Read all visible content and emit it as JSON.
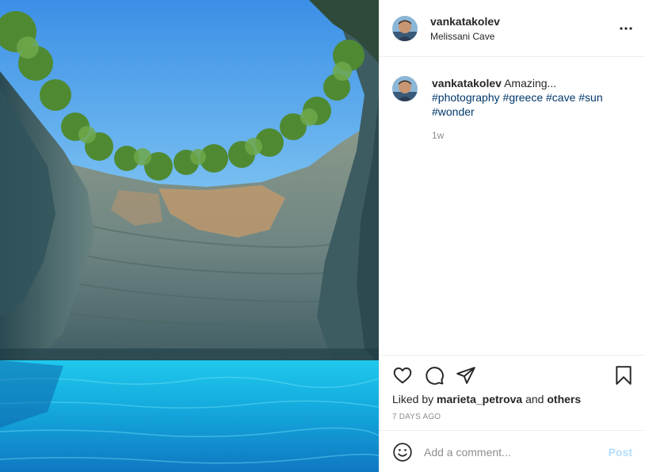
{
  "photo": {
    "description_icon": "photo-icon"
  },
  "header": {
    "username": "vankatakolev",
    "location": "Melissani Cave",
    "more_icon": "more-icon"
  },
  "caption": {
    "username": "vankatakolev",
    "text": "Amazing...",
    "hashtags": [
      "#photography",
      "#greece",
      "#cave",
      "#sun",
      "#wonder"
    ],
    "time": "1w"
  },
  "actions": {
    "like_icon": "heart-icon",
    "comment_icon": "comment-icon",
    "share_icon": "share-icon",
    "save_icon": "bookmark-icon"
  },
  "likes": {
    "prefix": "Liked by",
    "user": "marieta_petrova",
    "conjunction": "and",
    "others": "others"
  },
  "date": "7 DAYS AGO",
  "add_comment": {
    "emoji_icon": "emoji-icon",
    "placeholder": "Add a comment...",
    "post_label": "Post"
  },
  "colors": {
    "text": "#262626",
    "secondary": "#8e8e8e",
    "hashtag": "#00376b",
    "post_disabled": "#b2dffc",
    "border": "#efefef"
  }
}
